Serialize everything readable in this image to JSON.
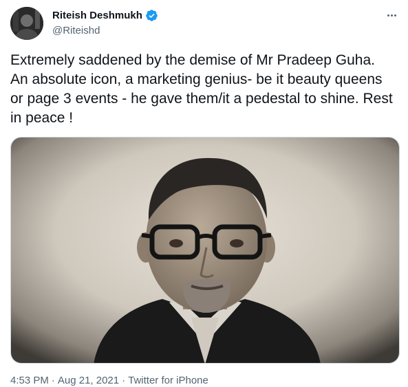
{
  "tweet": {
    "display_name": "Riteish Deshmukh",
    "handle": "@Riteishd",
    "verified": true,
    "text": "Extremely saddened by the demise of Mr Pradeep Guha. An absolute icon, a marketing genius- be it beauty queens or page 3 events - he gave them/it a pedestal to shine. Rest in peace !",
    "time": "4:53 PM",
    "separator": "·",
    "date": "Aug 21, 2021",
    "source": "Twitter for iPhone"
  },
  "icons": {
    "verified": "verified-badge-icon",
    "more": "more-options-icon"
  },
  "colors": {
    "verified_blue": "#1d9bf0",
    "secondary_text": "#536471",
    "primary_text": "#0f1419"
  }
}
